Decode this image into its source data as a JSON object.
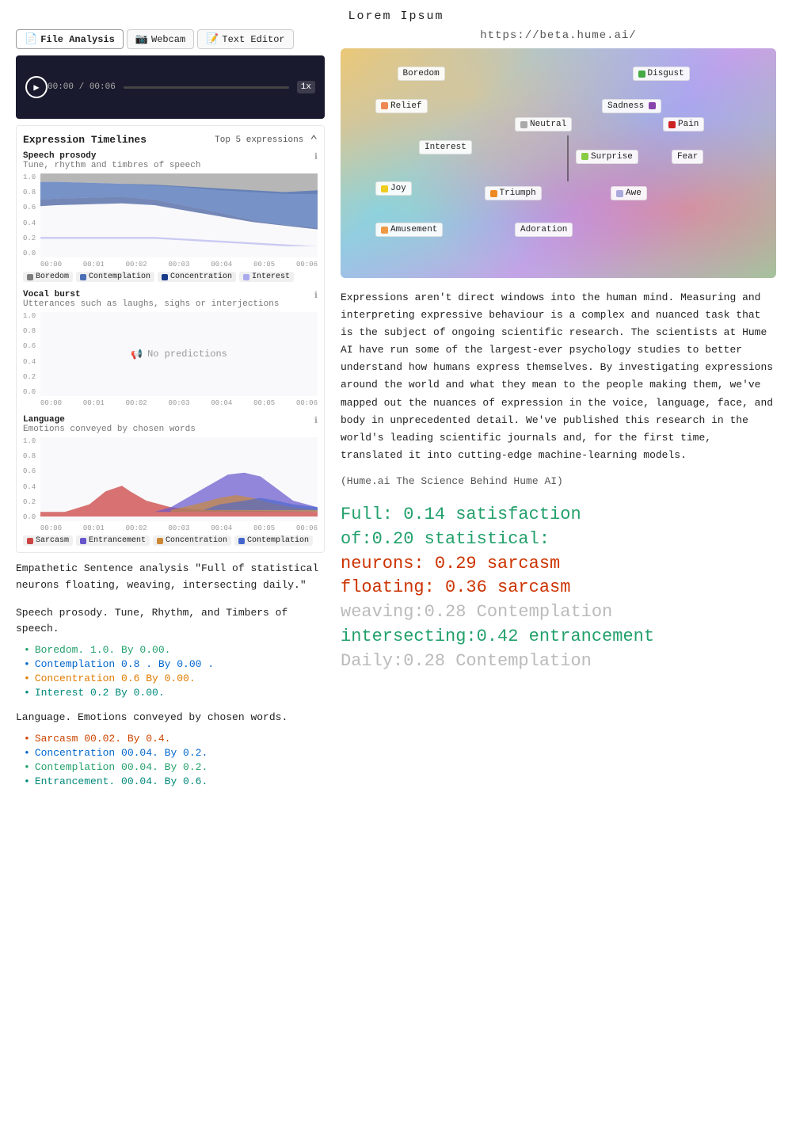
{
  "page": {
    "title": "Lorem Ipsum",
    "site_url": "https://beta.hume.ai/"
  },
  "tabs": [
    {
      "id": "file-analysis",
      "icon": "📄",
      "label": "File Analysis",
      "active": true
    },
    {
      "id": "webcam",
      "icon": "📷",
      "label": "Webcam",
      "active": false
    },
    {
      "id": "text-editor",
      "icon": "📝",
      "label": "Text Editor",
      "active": false
    }
  ],
  "video": {
    "time_current": "00:00",
    "time_total": "00:06",
    "speed": "1x"
  },
  "expression_timelines": {
    "label": "Expression Timelines",
    "top_expressions": "Top 5 expressions"
  },
  "speech_prosody": {
    "title": "Speech prosody",
    "subtitle": "Tune, rhythm and timbres of speech",
    "y_labels": [
      "1.0",
      "0.8",
      "0.6",
      "0.4",
      "0.2",
      "0.0"
    ],
    "x_labels": [
      "00:00",
      "00:01",
      "00:02",
      "00:03",
      "00:04",
      "00:05",
      "00:06"
    ],
    "legend": [
      {
        "name": "Boredom",
        "color": "#7c7c7c"
      },
      {
        "name": "Contemplation",
        "color": "#4a6fb5"
      },
      {
        "name": "Concentration",
        "color": "#1a3a8a"
      },
      {
        "name": "Interest",
        "color": "#aaaaee"
      }
    ]
  },
  "vocal_burst": {
    "title": "Vocal burst",
    "subtitle": "Utterances such as laughs, sighs or interjections",
    "no_predictions_label": "No predictions",
    "y_labels": [
      "1.0",
      "0.8",
      "0.6",
      "0.4",
      "0.2",
      "0.0"
    ],
    "x_labels": [
      "00:00",
      "00:01",
      "00:02",
      "00:03",
      "00:04",
      "00:05",
      "00:06"
    ]
  },
  "language_chart": {
    "title": "Language",
    "subtitle": "Emotions conveyed by chosen words",
    "y_labels": [
      "1.0",
      "0.8",
      "0.6",
      "0.4",
      "0.2",
      "0.0"
    ],
    "x_labels": [
      "00:00",
      "00:01",
      "00:02",
      "00:03",
      "00:04",
      "00:05",
      "00:06"
    ],
    "legend": [
      {
        "name": "Sarcasm",
        "color": "#cc4444"
      },
      {
        "name": "Entrancement",
        "color": "#6655cc"
      },
      {
        "name": "Concentration",
        "color": "#cc8833"
      },
      {
        "name": "Contemplation",
        "color": "#4466cc"
      }
    ]
  },
  "left_text": {
    "empathetic_label": "Empathetic Sentence analysis \"Full of statistical neurons floating, weaving, intersecting daily.\"",
    "speech_prosody_label": "Speech prosody. Tune, Rhythm, and Timbers of speech.",
    "speech_bullets": [
      {
        "text": "Boredom. 1.0. By 0.00.",
        "color": "green"
      },
      {
        "text": "Contemplation 0.8 . By 0.00 .",
        "color": "blue"
      },
      {
        "text": "Concentration 0.6 By 0.00.",
        "color": "orange"
      },
      {
        "text": "Interest 0.2 By 0.00.",
        "color": "teal"
      }
    ],
    "language_label": "Language. Emotions conveyed by chosen words.",
    "language_bullets": [
      {
        "text": "Sarcasm 00.02. By 0.4.",
        "color": "red-orange"
      },
      {
        "text": "Concentration 00.04. By 0.2.",
        "color": "blue"
      },
      {
        "text": "Contemplation 00.04. By 0.2.",
        "color": "green"
      },
      {
        "text": "Entrancement. 00.04. By 0.6.",
        "color": "teal"
      }
    ]
  },
  "emotion_labels": [
    {
      "name": "Boredom",
      "color": null,
      "top": "8%",
      "left": "13%"
    },
    {
      "name": "Disgust",
      "color": "#44aa44",
      "top": "8%",
      "left": "67%"
    },
    {
      "name": "Relief",
      "color": "#ee8855",
      "top": "22%",
      "left": "8%"
    },
    {
      "name": "Sadness",
      "color": "#8844aa",
      "top": "22%",
      "left": "60%"
    },
    {
      "name": "Neutral",
      "color": "#aaaaaa",
      "top": "30%",
      "left": "40%"
    },
    {
      "name": "Pain",
      "color": "#cc2222",
      "top": "30%",
      "left": "74%"
    },
    {
      "name": "Interest",
      "color": null,
      "top": "40%",
      "left": "18%"
    },
    {
      "name": "Surprise",
      "color": "#88cc44",
      "top": "44%",
      "left": "54%"
    },
    {
      "name": "Fear",
      "color": null,
      "top": "44%",
      "left": "76%"
    },
    {
      "name": "Joy",
      "color": "#eecc22",
      "top": "58%",
      "left": "8%"
    },
    {
      "name": "Triumph",
      "color": "#ee8822",
      "top": "60%",
      "left": "33%"
    },
    {
      "name": "Awe",
      "color": "#aaaadd",
      "top": "60%",
      "left": "61%"
    },
    {
      "name": "Amusement",
      "color": "#ee9944",
      "top": "76%",
      "left": "8%"
    },
    {
      "name": "Adoration",
      "color": null,
      "top": "76%",
      "left": "38%"
    }
  ],
  "description": "Expressions aren't direct windows into the human mind. Measuring and interpreting expressive behaviour is a complex and nuanced task that is the subject of ongoing scientific research. The scientists at Hume AI have run some of the largest-ever psychology studies to better understand how humans express themselves. By investigating expressions around the world and what they mean to the people making them, we've mapped out the nuances of expression in the voice, language, face, and body in unprecedented detail. We've published this research in the world's leading scientific journals and, for the first time, translated it into cutting-edge machine-learning models.",
  "source": "(Hume.ai The Science Behind Hume AI)",
  "analysis_output": {
    "line1_green": "Full: 0.14 satisfaction",
    "line2_green": "of:0.20 statistical:",
    "line3_red": "neurons: 0.29 sarcasm",
    "line4_red": "floating: 0.36 sarcasm",
    "line5_gray": "weaving:0.28 Contemplation",
    "line6_green": "intersecting:0.42 entrancement",
    "line7_gray": "Daily:0.28 Contemplation"
  }
}
